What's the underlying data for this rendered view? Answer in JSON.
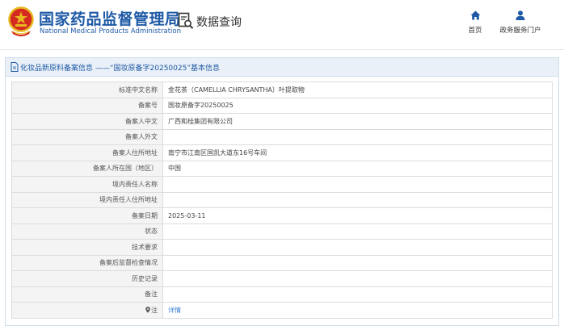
{
  "header": {
    "site_title_cn": "国家药品监督管理局",
    "site_title_en": "National Medical Products Administration",
    "page_title": "数据查询",
    "nav": [
      {
        "label": "首页",
        "icon": "home-icon"
      },
      {
        "label": "政务服务门户",
        "icon": "user-icon"
      }
    ]
  },
  "panel": {
    "title": "化妆品新原料备案信息 ——“国妆原备字20250025”基本信息",
    "rows": [
      {
        "label": "标准中文名称",
        "value": "金花茶（CAMELLIA CHRYSANTHA）叶提取物"
      },
      {
        "label": "备案号",
        "value": "国妆原备字20250025"
      },
      {
        "label": "备案人中文",
        "value": "广西和桂集团有限公司"
      },
      {
        "label": "备案人外文",
        "value": ""
      },
      {
        "label": "备案人住所地址",
        "value": "南宁市江南区国凯大道东16号车间"
      },
      {
        "label": "备案人所在国（地区）",
        "value": "中国"
      },
      {
        "label": "境内责任人名称",
        "value": ""
      },
      {
        "label": "境内责任人住所地址",
        "value": ""
      },
      {
        "label": "备案日期",
        "value": "2025-03-11"
      },
      {
        "label": "状态",
        "value": ""
      },
      {
        "label": "技术要求",
        "value": ""
      },
      {
        "label": "备案后监督检查情况",
        "value": ""
      },
      {
        "label": "历史记录",
        "value": ""
      },
      {
        "label": "备注",
        "value": ""
      }
    ],
    "note_row": {
      "label": "注",
      "link": "详情",
      "icon": "pin-icon"
    }
  },
  "colors": {
    "brand_blue": "#1f5aa6",
    "link_blue": "#3a7fd0",
    "panel_header_bg": "#e9f0f7",
    "emblem_red": "#d42a20",
    "emblem_gold": "#e8b81f"
  }
}
